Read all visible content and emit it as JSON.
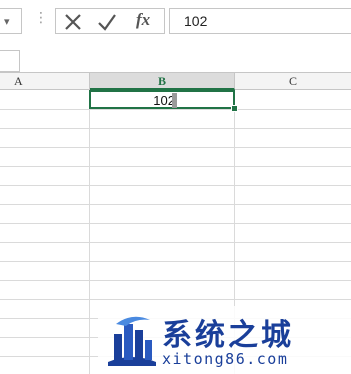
{
  "formula_bar": {
    "name_box_dropdown_icon": "chevron-down-icon",
    "separator_icon": "vertical-dots-icon",
    "cancel_icon": "close-icon",
    "confirm_icon": "checkmark-icon",
    "function_label": "fx",
    "formula_value": "102"
  },
  "sheet": {
    "columns": [
      "A",
      "B",
      "C"
    ],
    "active_column": "B",
    "active_cell_value": "102"
  },
  "watermark": {
    "title": "系统之城",
    "url": "xitong86.com"
  },
  "colors": {
    "accent": "#217346",
    "watermark": "#1a3f9a"
  }
}
